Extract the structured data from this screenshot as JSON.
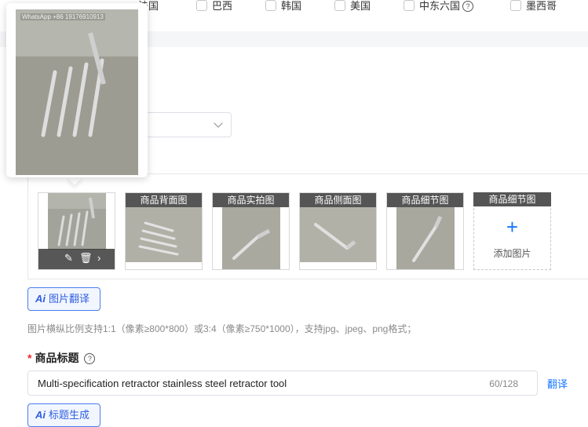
{
  "countries": [
    {
      "label": "法国"
    },
    {
      "label": "巴西"
    },
    {
      "label": "韩国"
    },
    {
      "label": "美国"
    },
    {
      "label": "中东六国"
    },
    {
      "label": "墨西哥"
    }
  ],
  "popover": {
    "watermark": "WhatsApp +86 19176910913"
  },
  "images": {
    "main": {
      "edit_icon": "edit-icon",
      "delete_icon": "trash-icon",
      "next_icon": "chevron-right-icon"
    },
    "thumbs": [
      {
        "label": "商品背面图"
      },
      {
        "label": "商品实拍图"
      },
      {
        "label": "商品侧面图"
      },
      {
        "label": "商品细节图"
      }
    ],
    "add": {
      "header": "商品细节图",
      "label": "添加图片"
    }
  },
  "ai_translate": {
    "icon": "Ai",
    "label": "图片翻译"
  },
  "hint": "图片横纵比例支持1:1（像素≥800*800）或3:4（像素≥750*1000），支持jpg、jpeg、png格式；",
  "title_field": {
    "required": "*",
    "label": "商品标题",
    "help": "?",
    "value": "Multi-specification retractor stainless steel retractor tool",
    "count": "60/128",
    "translate": "翻译"
  },
  "title_gen": {
    "icon": "Ai",
    "label": "标题生成"
  },
  "colors": {
    "accent": "#1677ff",
    "thumb_header": "#555555",
    "required": "#f5222d"
  }
}
